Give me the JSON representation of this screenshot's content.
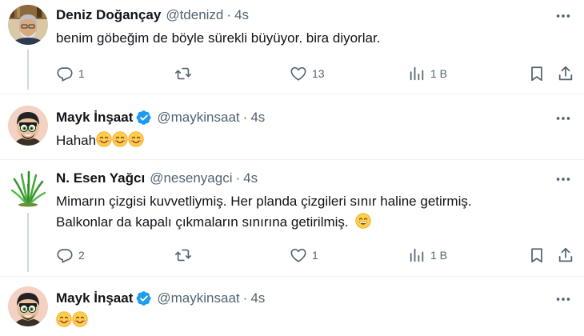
{
  "tweets": [
    {
      "name": "Deniz Doğançay",
      "handle": "@tdenizd",
      "time": "4s",
      "text": "benim göbeğim de böyle sürekli büyüyor. bira diyorlar.",
      "stats": {
        "replies": "1",
        "likes": "13",
        "views": "1 B"
      }
    },
    {
      "name": "Mayk İnşaat",
      "handle": "@maykinsaat",
      "time": "4s",
      "text": "Hahah"
    },
    {
      "name": "N. Esen Yağcı",
      "handle": "@nesenyagci",
      "time": "4s",
      "text_line1": "Mimarın çizgisi kuvvetliymiş. Her planda çizgileri sınır haline getirmiş.",
      "text_line2": "Balkonlar da kapalı çıkmaların sınırına getirilmiş.",
      "stats": {
        "replies": "2",
        "likes": "1",
        "views": "1 B"
      }
    },
    {
      "name": "Mayk İnşaat",
      "handle": "@maykinsaat",
      "time": "4s"
    }
  ],
  "separator": "·",
  "icons": [
    "more-icon",
    "reply-icon",
    "retweet-icon",
    "like-icon",
    "views-icon",
    "bookmark-icon",
    "share-icon",
    "verified-badge-icon",
    "smiling-face-emoji",
    "grinning-face-emoji"
  ],
  "colors": {
    "text": "#0f1419",
    "muted": "#536471",
    "verified": "#1d9bf0",
    "divider": "#eff3f4",
    "thread": "#cfd9de"
  }
}
